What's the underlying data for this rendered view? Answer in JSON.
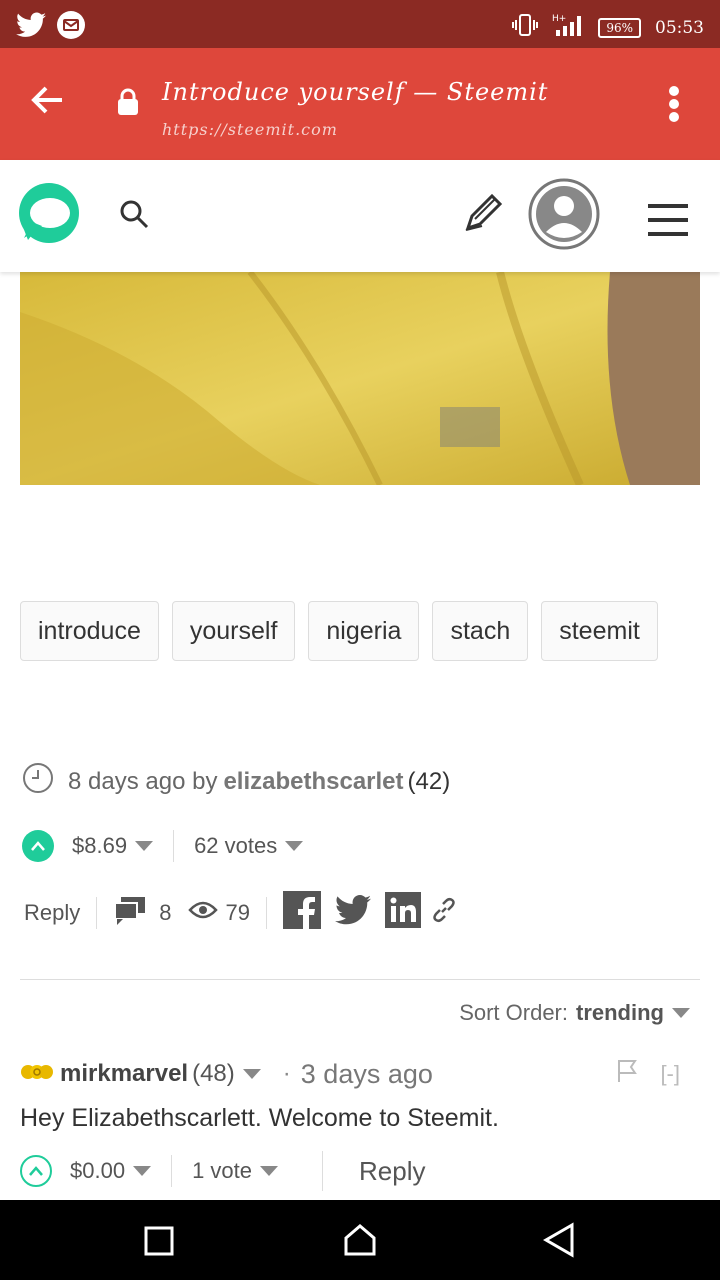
{
  "status_bar": {
    "battery": "96%",
    "time": "05:53"
  },
  "browser": {
    "title": "Introduce yourself — Steemit",
    "url": "https://steemit.com"
  },
  "tags": [
    "introduce",
    "yourself",
    "nigeria",
    "stach",
    "steemit"
  ],
  "post_meta": {
    "age": "8 days ago by",
    "author": "elizabethscarlet",
    "reputation": "(42)"
  },
  "post_votes": {
    "payout": "$8.69",
    "votes": "62 votes"
  },
  "post_actions": {
    "reply_label": "Reply",
    "comments": "8",
    "views": "79"
  },
  "sort": {
    "label": "Sort Order:",
    "value": "trending"
  },
  "comment": {
    "author": "mirkmarvel",
    "reputation": "(48)",
    "bullet": "·",
    "age": "3 days ago",
    "collapse": "[-]",
    "body": "Hey Elizabethscarlett. Welcome to Steemit.",
    "payout": "$0.00",
    "votes": "1 vote",
    "reply_label": "Reply"
  },
  "colors": {
    "status_bar": "#8b2a23",
    "browser_bar": "#de473b",
    "accent": "#1fcc9a"
  }
}
